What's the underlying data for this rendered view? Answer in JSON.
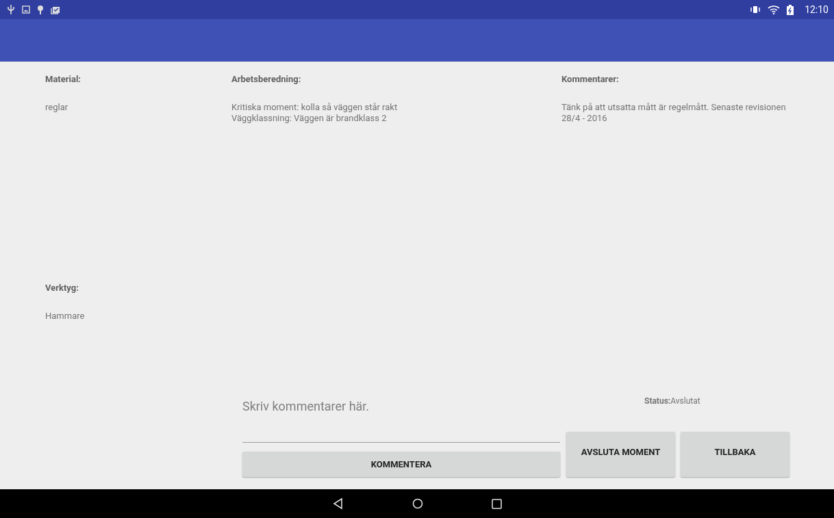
{
  "status_bar": {
    "time": "12:10"
  },
  "material": {
    "label": "Material:",
    "value": "reglar"
  },
  "verktyg": {
    "label": "Verktyg:",
    "value": "Hammare"
  },
  "arbetsberedning": {
    "label": "Arbetsberedning:",
    "lines": [
      "Kritiska moment: kolla så väggen står rakt",
      "Väggklassning: Väggen är brandklass 2"
    ]
  },
  "kommentarer": {
    "label": "Kommentarer:",
    "text": "Tänk på att utsatta mått är regelmått. Senaste revisionen 28/4 - 2016"
  },
  "comment_field": {
    "placeholder": "Skriv kommentarer här."
  },
  "status": {
    "label": "Status:",
    "value": "Avslutat"
  },
  "buttons": {
    "comment": "KOMMENTERA",
    "finish": "AVSLUTA MOMENT",
    "back": "TILLBAKA"
  }
}
